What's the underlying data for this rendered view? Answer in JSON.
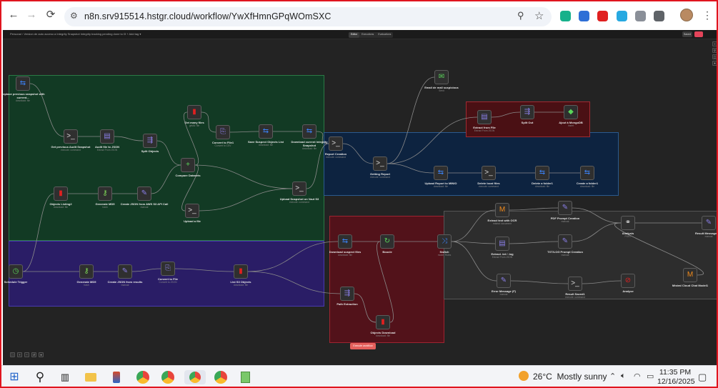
{
  "browser": {
    "url": "n8n.srv915514.hstgr.cloud/workflow/YwXfHmnGPqWOmSXC",
    "back_icon": "←",
    "forward_icon": "→",
    "reload_icon": "⟳",
    "tune_icon": "⚙",
    "zoom_icon": "⚲",
    "star_icon": "☆",
    "extensions": [
      {
        "name": "extension-green",
        "color": "#17b18b"
      },
      {
        "name": "extension-blue",
        "color": "#2f6fd6"
      },
      {
        "name": "extension-red",
        "color": "#e02020"
      },
      {
        "name": "extension-cyan",
        "color": "#27a9e1"
      },
      {
        "name": "extension-camera",
        "color": "#8a8f98"
      },
      {
        "name": "extension-puzzle",
        "color": "#5f6368"
      }
    ]
  },
  "app": {
    "breadcrumb": "Personal  ›  Version de auto acceso a Integrity Snapshot Integrity tracking pending done to l3   + Add tag  ▾",
    "tabs": [
      "Editor",
      "Executions",
      "Evaluations"
    ],
    "save_label": "Saved",
    "run_button": "Execute workflow",
    "accent": "#e4605c"
  },
  "groups": [
    {
      "name": "group-green-main",
      "color": "#123a24",
      "border": "#2a7a45"
    },
    {
      "name": "group-purple-schedule",
      "color": "#2a1d66",
      "border": "#4a3ab0"
    },
    {
      "name": "group-blue-report",
      "color": "#0d2340",
      "border": "#2a5a8f"
    },
    {
      "name": "group-red-email",
      "color": "#4a1014",
      "border": "#a02a32"
    },
    {
      "name": "group-red-download",
      "color": "#52121a",
      "border": "#9e2430"
    },
    {
      "name": "group-gray-extraction",
      "color": "#2d2d2d",
      "border": "#555555"
    }
  ],
  "nodes": [
    {
      "id": "replace-previous",
      "label": "Replace previous snapshot with current...",
      "sub": "download: file",
      "icon": "⇆",
      "color": "#3b82f6"
    },
    {
      "id": "get-previous-audit",
      "label": "Get previous Audit Snapshot",
      "sub": "execute: command",
      "icon": ">_",
      "color": "#d9d9d9"
    },
    {
      "id": "audit-to-json",
      "label": "Audit file to JSON",
      "sub": "Extract From JSON",
      "icon": "▤",
      "color": "#8b7fe8"
    },
    {
      "id": "split-objects",
      "label": "Split Objects",
      "sub": "",
      "icon": "⇶",
      "color": "#8b7fe8"
    },
    {
      "id": "get-many-files",
      "label": "Get many files",
      "sub": "getAll: file",
      "icon": "▮",
      "color": "#e02020"
    },
    {
      "id": "convert-to-file",
      "label": "Convert to File1",
      "sub": "Convert to CSV",
      "icon": "⎘",
      "color": "#8b7fe8"
    },
    {
      "id": "save-suspect",
      "label": "Save Suspect Objects List",
      "sub": "download: file",
      "icon": "⇆",
      "color": "#3b82f6"
    },
    {
      "id": "download-current",
      "label": "Download current Integrity Snapshot",
      "sub": "download: file",
      "icon": "⇆",
      "color": "#3b82f6"
    },
    {
      "id": "objects-listing",
      "label": "Objects Listing2",
      "sub": "download: file",
      "icon": "▮",
      "color": "#e02020"
    },
    {
      "id": "generate-md5",
      "label": "Generate MD5",
      "sub": "hash",
      "icon": "⚷",
      "color": "#7ed957"
    },
    {
      "id": "create-json-aws",
      "label": "Create JSON from AWS S3 API Call",
      "sub": "manual",
      "icon": "✎",
      "color": "#8b7fe8"
    },
    {
      "id": "compare-datasets",
      "label": "Compare Datasets",
      "sub": "",
      "icon": "+",
      "color": "#5ad65a"
    },
    {
      "id": "upload-file",
      "label": "Upload a file",
      "sub": "",
      "icon": ">_",
      "color": "#d9d9d9"
    },
    {
      "id": "upload-snapshot",
      "label": "Upload Snapshot on Vaut S3",
      "sub": "execute: command",
      "icon": ">_",
      "color": "#d9d9d9"
    },
    {
      "id": "report-creation",
      "label": "Report Creation",
      "sub": "execute: command",
      "icon": ">_",
      "color": "#d9d9d9"
    },
    {
      "id": "getting-report",
      "label": "Getting Report",
      "sub": "execute: command",
      "icon": ">_",
      "color": "#d9d9d9"
    },
    {
      "id": "email-suspicious",
      "label": "Email de mail suspicious",
      "sub": "Send",
      "icon": "✉",
      "color": "#5ad65a"
    },
    {
      "id": "extract-from-file",
      "label": "Extract from File",
      "sub": "Extract From JSON",
      "icon": "▤",
      "color": "#8b7fe8"
    },
    {
      "id": "split-out",
      "label": "Split Out",
      "sub": "",
      "icon": "⇶",
      "color": "#8b7fe8"
    },
    {
      "id": "ajout-mongodb",
      "label": "Ajout à MongoDB",
      "sub": "Insert",
      "icon": "◆",
      "color": "#5ad65a"
    },
    {
      "id": "upload-report-minio",
      "label": "Upload Report to MINIO",
      "sub": "download: file",
      "icon": "⇆",
      "color": "#3b82f6"
    },
    {
      "id": "delete-local-files",
      "label": "Delete local files",
      "sub": "execute: command",
      "icon": ">_",
      "color": "#d9d9d9"
    },
    {
      "id": "delete-folder",
      "label": "Delete a folder1",
      "sub": "download: file",
      "icon": "⇆",
      "color": "#3b82f6"
    },
    {
      "id": "create-folder",
      "label": "Create a folder1",
      "sub": "download: file",
      "icon": "⇆",
      "color": "#3b82f6"
    },
    {
      "id": "schedule-trigger",
      "label": "Schedule Trigger",
      "sub": "",
      "icon": "◷",
      "color": "#5ad65a"
    },
    {
      "id": "generate-md5-2",
      "label": "Generate MD5",
      "sub": "hash",
      "icon": "⚷",
      "color": "#7ed957"
    },
    {
      "id": "create-json-results",
      "label": "Create JSON from results",
      "sub": "manual",
      "icon": "✎",
      "color": "#8b7fe8"
    },
    {
      "id": "convert-to-file-2",
      "label": "Convert to File",
      "sub": "Convert to JSON",
      "icon": "⎘",
      "color": "#8b7fe8"
    },
    {
      "id": "list-s3-objects",
      "label": "List S3 Objects",
      "sub": "download: file",
      "icon": "▮",
      "color": "#e02020"
    },
    {
      "id": "download-suspect",
      "label": "Download suspect files",
      "sub": "download: file",
      "icon": "⇆",
      "color": "#3b82f6"
    },
    {
      "id": "boucle",
      "label": "Boucle",
      "sub": "",
      "icon": "↻",
      "color": "#5ad65a"
    },
    {
      "id": "switch",
      "label": "Switch",
      "sub": "mode: Rules",
      "icon": "⤨",
      "color": "#3b82f6"
    },
    {
      "id": "path-extraction",
      "label": "Path Extraction",
      "sub": "",
      "icon": "⇶",
      "color": "#8b7fe8"
    },
    {
      "id": "objects-download",
      "label": "Objects Download",
      "sub": "download: file",
      "icon": "▮",
      "color": "#e02020"
    },
    {
      "id": "extract-text-ocr",
      "label": "Extract text with OCR",
      "sub": "mistral: document",
      "icon": "M",
      "color": "#f08a1c"
    },
    {
      "id": "extract-txt-log",
      "label": "Extract .txt / .log",
      "sub": "Extract From JSON",
      "icon": "▤",
      "color": "#8b7fe8"
    },
    {
      "id": "error-message",
      "label": "Error Message (F)",
      "sub": "manual",
      "icon": "✎",
      "color": "#8b7fe8"
    },
    {
      "id": "pdf-prompt",
      "label": "PDF Prompt Creation",
      "sub": "manual",
      "icon": "✎",
      "color": "#8b7fe8"
    },
    {
      "id": "txt-prompt",
      "label": "TXT/LOG Prompt Creation",
      "sub": "manual",
      "icon": "✎",
      "color": "#8b7fe8"
    },
    {
      "id": "result-saved",
      "label": "Result Saved1",
      "sub": "execute: command",
      "icon": ">_",
      "color": "#d9d9d9"
    },
    {
      "id": "analysis",
      "label": "Analyse",
      "sub": "",
      "icon": "⊘",
      "color": "#e02020"
    },
    {
      "id": "mistral-model",
      "label": "Mistral Cloud Chat Model1",
      "sub": "",
      "icon": "M",
      "color": "#f08a1c"
    },
    {
      "id": "analysis-http",
      "label": "Analysis",
      "sub": "POST",
      "icon": "⚭",
      "color": "#d9d9d9"
    },
    {
      "id": "result-message",
      "label": "Result Message Cre",
      "sub": "manual",
      "icon": "✎",
      "color": "#8b7fe8"
    }
  ],
  "taskbar": {
    "weather_temp": "26°C",
    "weather_text": "Mostly sunny",
    "time": "11:35 PM",
    "date": "12/16/2025"
  }
}
